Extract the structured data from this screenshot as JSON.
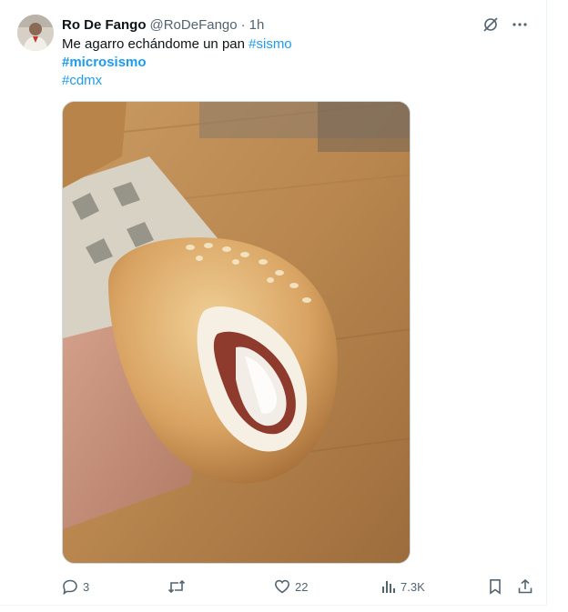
{
  "tweet": {
    "display_name": "Ro De Fango",
    "handle": "@RoDeFango",
    "separator": "·",
    "time": "1h",
    "text": "Me agarro echándome un pan ",
    "hashtag_sismo": "#sismo",
    "hashtag_microsismo": "#microsismo",
    "hashtag_cdmx": "#cdmx"
  },
  "header_actions": {
    "icons": [
      "grok-icon",
      "more-icon"
    ]
  },
  "actions": {
    "replies": "3",
    "retweets": "",
    "likes": "22",
    "views": "7.3K"
  },
  "colors": {
    "accent": "#1d9bf0",
    "text": "#0f1419",
    "muted": "#536471"
  }
}
